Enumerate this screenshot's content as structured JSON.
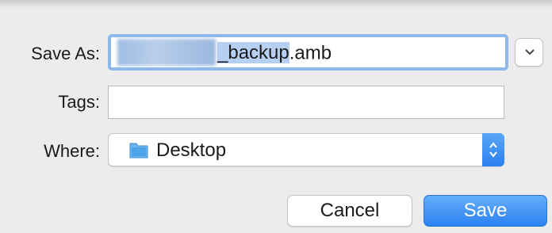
{
  "dialog": {
    "save_as": {
      "label": "Save As:",
      "value_suffix": "_backup.amb",
      "selected_text": "_backup",
      "unselected_text": ".amb"
    },
    "tags": {
      "label": "Tags:",
      "value": ""
    },
    "where": {
      "label": "Where:",
      "selected_value": "Desktop",
      "icon": "folder-icon"
    },
    "buttons": {
      "cancel_label": "Cancel",
      "save_label": "Save"
    }
  },
  "colors": {
    "accent": "#2c82f2",
    "focus_ring": "#8fb8ec",
    "selection": "#b6d0f2",
    "background": "#ececec"
  }
}
